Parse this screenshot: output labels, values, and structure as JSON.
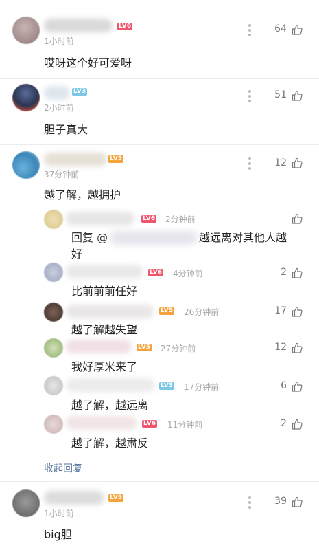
{
  "comments": [
    {
      "time": "1小时前",
      "text": "哎呀这个好可爱呀",
      "likes": "64",
      "badge": "LV6",
      "badge_color": "#f0556f"
    },
    {
      "time": "2小时前",
      "text": "胆子真大",
      "likes": "51",
      "badge": "LV3",
      "badge_color": "#7ac7e6"
    },
    {
      "time": "37分钟前",
      "text": "越了解，越拥护",
      "likes": "12",
      "badge": "LV5",
      "badge_color": "#f5a33c"
    },
    {
      "time": "1小时前",
      "text": "big胆",
      "likes": "39",
      "badge": "LV5",
      "badge_color": "#f5a33c"
    }
  ],
  "replies": [
    {
      "time": "2分钟前",
      "badge": "LV6",
      "badge_color": "#f0556f",
      "reply_prefix": "回复 @",
      "text_line1": "越远离对其他人越",
      "text_line2": "好",
      "likes": ""
    },
    {
      "time": "4分钟前",
      "badge": "LV6",
      "badge_color": "#f0556f",
      "text": "比前前前任好",
      "likes": "2"
    },
    {
      "time": "26分钟前",
      "badge": "LV5",
      "badge_color": "#f5a33c",
      "text": "越了解越失望",
      "likes": "17"
    },
    {
      "time": "27分钟前",
      "badge": "LV5",
      "badge_color": "#f5a33c",
      "text": "我好厚米来了",
      "likes": "12"
    },
    {
      "time": "17分钟前",
      "badge": "LV3",
      "badge_color": "#7ac7e6",
      "text": "越了解，越远离",
      "likes": "6"
    },
    {
      "time": "11分钟前",
      "badge": "LV6",
      "badge_color": "#f0556f",
      "text": "越了解，越肃反",
      "likes": "2"
    }
  ],
  "collapse_label": "收起回复",
  "icons": {
    "more": "more-vertical-icon",
    "like": "thumb-up-icon"
  }
}
